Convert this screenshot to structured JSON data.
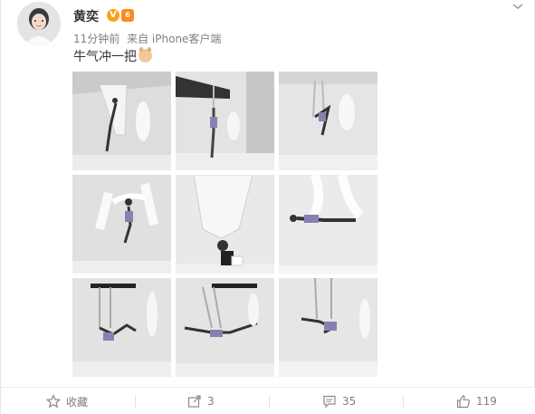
{
  "post": {
    "author": {
      "name": "黄奕",
      "verified_badge": "V",
      "level_badge": "6"
    },
    "time": "11分钟前",
    "source": "来自 iPhone客户端",
    "text": "牛气冲一把",
    "emoji": "ox-face-emoji",
    "photos": [
      {
        "alt_scene": "aerial-silk-pose-1"
      },
      {
        "alt_scene": "aerial-silk-pose-2"
      },
      {
        "alt_scene": "aerial-silk-pose-3"
      },
      {
        "alt_scene": "aerial-silk-pose-4"
      },
      {
        "alt_scene": "aerial-silk-pose-5"
      },
      {
        "alt_scene": "aerial-silk-pose-6"
      },
      {
        "alt_scene": "aerial-silk-pose-7"
      },
      {
        "alt_scene": "aerial-silk-pose-8"
      },
      {
        "alt_scene": "aerial-silk-pose-9"
      }
    ]
  },
  "actions": {
    "favorite": {
      "label": "收藏",
      "icon": "star-icon"
    },
    "repost": {
      "count": "3",
      "icon": "share-icon"
    },
    "comment": {
      "count": "35",
      "icon": "comment-icon"
    },
    "like": {
      "count": "119",
      "icon": "thumbs-up-icon"
    }
  },
  "colors": {
    "badge_v": "#f7a21b",
    "badge_level": "#ff8a1d",
    "meta_text": "#808080"
  }
}
